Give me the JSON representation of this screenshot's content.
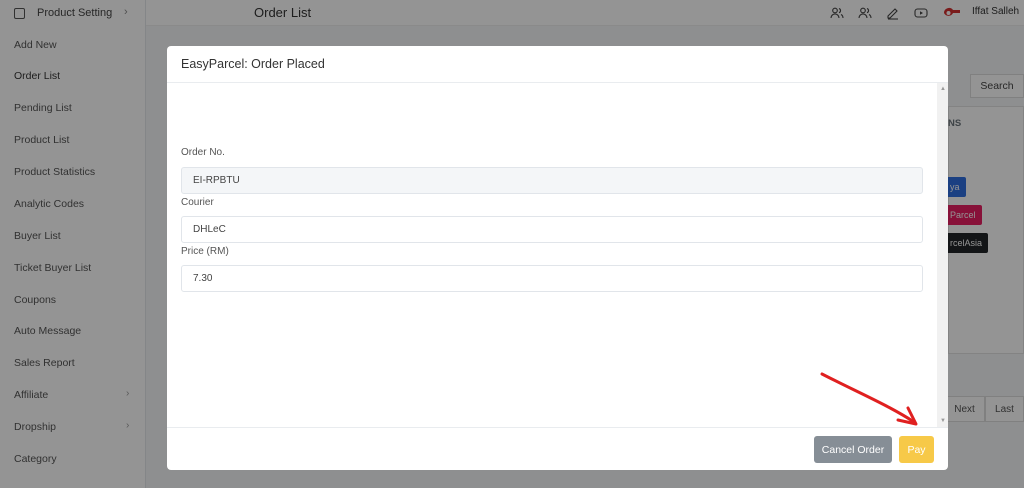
{
  "sidebar": {
    "header": "Product Setting",
    "items": [
      {
        "label": "Add New"
      },
      {
        "label": "Order List"
      },
      {
        "label": "Pending List"
      },
      {
        "label": "Product List"
      },
      {
        "label": "Product Statistics"
      },
      {
        "label": "Analytic Codes"
      },
      {
        "label": "Buyer List"
      },
      {
        "label": "Ticket Buyer List"
      },
      {
        "label": "Coupons"
      },
      {
        "label": "Auto Message"
      },
      {
        "label": "Sales Report"
      },
      {
        "label": "Affiliate"
      },
      {
        "label": "Dropship"
      },
      {
        "label": "Category"
      }
    ]
  },
  "topbar": {
    "page_title": "Order List",
    "user_name": "Iffat Salleh"
  },
  "background": {
    "search_label": "Search",
    "actions_header": "NS",
    "buttons": [
      {
        "label": "ya",
        "color": "#2f6fe0"
      },
      {
        "label": "Parcel",
        "color": "#e91e63"
      },
      {
        "label": "rcelAsia",
        "color": "#212529"
      }
    ],
    "pager": {
      "next": "Next",
      "last": "Last"
    }
  },
  "modal": {
    "title": "EasyParcel: Order Placed",
    "fields": {
      "order_no": {
        "label": "Order No.",
        "value": "EI-RPBTU"
      },
      "courier": {
        "label": "Courier",
        "value": "DHLeC"
      },
      "price": {
        "label": "Price (RM)",
        "value": "7.30"
      }
    },
    "footer": {
      "cancel_label": "Cancel Order",
      "pay_label": "Pay"
    }
  },
  "colors": {
    "cancel_button": "#868e96",
    "pay_button": "#f7c948",
    "annotation_arrow": "#e02020"
  }
}
